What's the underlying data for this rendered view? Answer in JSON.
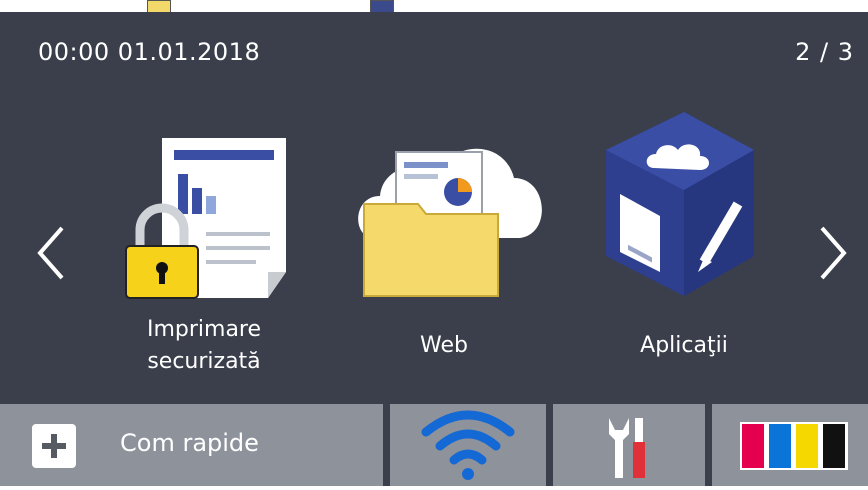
{
  "status": {
    "datetime": "00:00  01.01.2018",
    "page": "2 / 3"
  },
  "nav": {
    "prev": "previous-page",
    "next": "next-page"
  },
  "tiles": [
    {
      "label_line1": "Imprimare",
      "label_line2": "securizată",
      "icon": "secure-print-icon"
    },
    {
      "label": "Web",
      "icon": "web-cloud-folder-icon"
    },
    {
      "label": "Aplicaţii",
      "icon": "apps-cube-icon"
    }
  ],
  "bottom": {
    "quick_label": "Com rapide",
    "wifi_icon": "wifi-icon",
    "tools_icon": "settings-tools-icon",
    "toner_icon": "toner-levels-icon",
    "toner_colors": [
      "#e4004f",
      "#0a74d8",
      "#f5d800",
      "#111111"
    ]
  }
}
